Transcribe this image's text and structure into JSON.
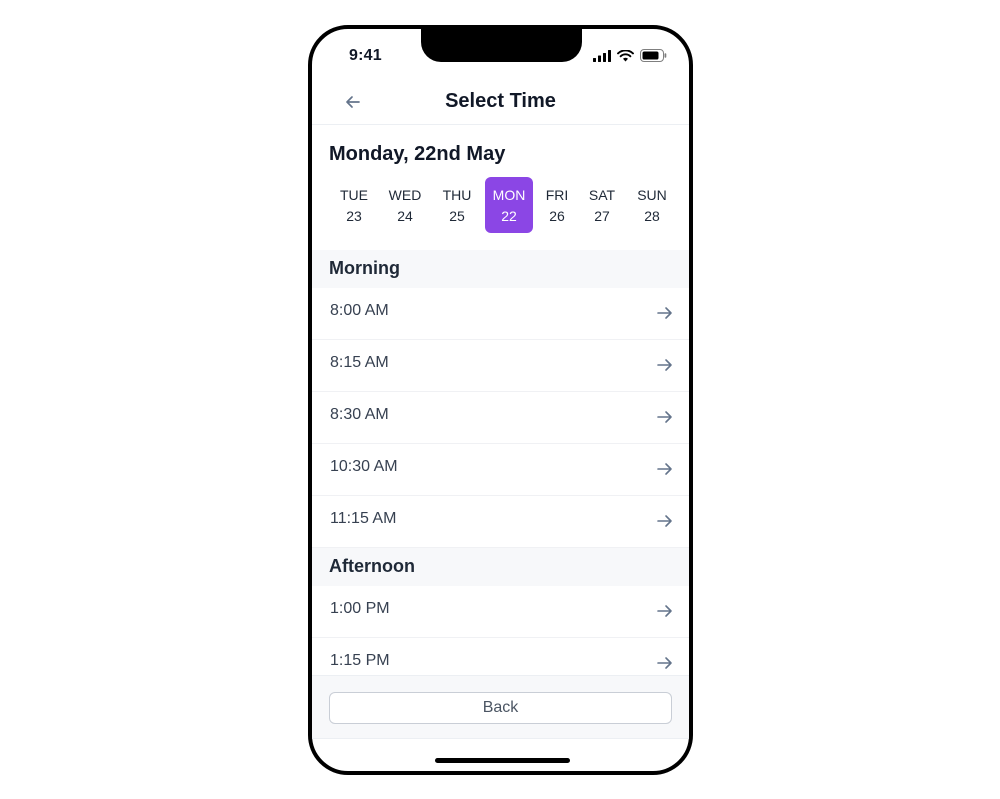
{
  "status_bar": {
    "time": "9:41"
  },
  "header": {
    "title": "Select Time"
  },
  "date_heading": "Monday, 22nd May",
  "days": [
    {
      "dow": "TUE",
      "num": "23",
      "selected": false
    },
    {
      "dow": "WED",
      "num": "24",
      "selected": false
    },
    {
      "dow": "THU",
      "num": "25",
      "selected": false
    },
    {
      "dow": "MON",
      "num": "22",
      "selected": true
    },
    {
      "dow": "FRI",
      "num": "26",
      "selected": false
    },
    {
      "dow": "SAT",
      "num": "27",
      "selected": false
    },
    {
      "dow": "SUN",
      "num": "28",
      "selected": false
    }
  ],
  "sections": {
    "morning": {
      "label": "Morning",
      "slots": [
        "8:00 AM",
        "8:15 AM",
        "8:30 AM",
        "10:30 AM",
        "11:15 AM"
      ]
    },
    "afternoon": {
      "label": "Afternoon",
      "slots": [
        "1:00 PM",
        "1:15 PM"
      ]
    }
  },
  "footer": {
    "back_label": "Back"
  },
  "colors": {
    "accent": "#8b46e5",
    "arrow": "#64748b"
  },
  "icons": {
    "back": "arrow-left-icon",
    "slot": "arrow-right-icon",
    "signal": "cellular-signal-icon",
    "wifi": "wifi-icon",
    "battery": "battery-icon"
  }
}
